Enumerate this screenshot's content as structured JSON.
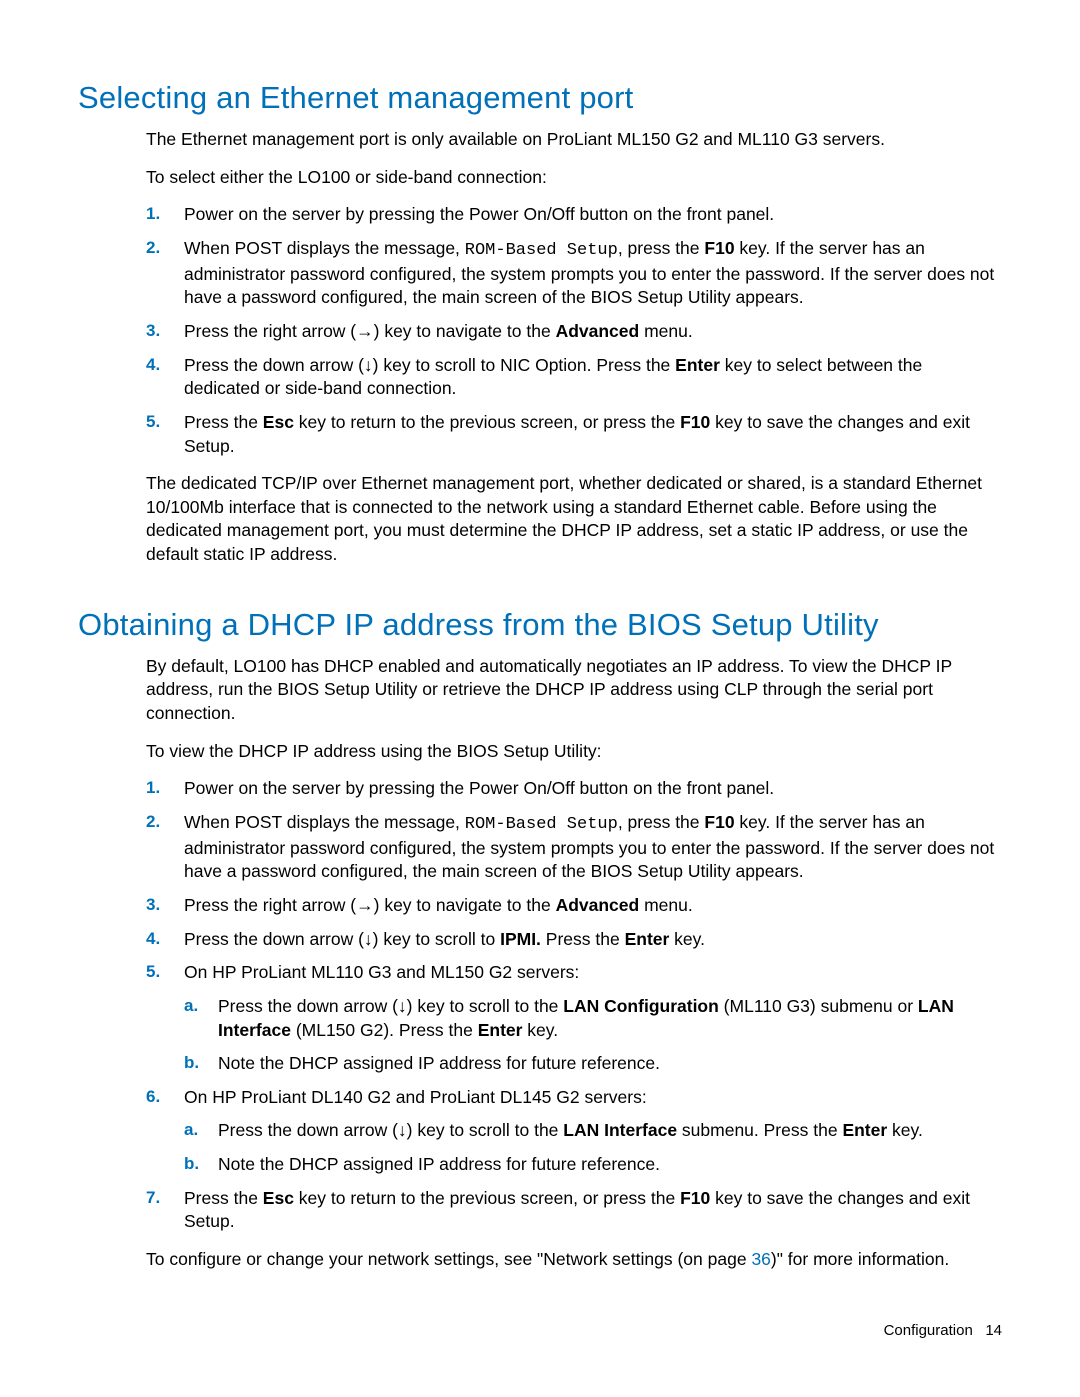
{
  "section1": {
    "title": "Selecting an Ethernet management port",
    "p1": "The Ethernet management port is only available on ProLiant ML150 G2 and ML110 G3 servers.",
    "p2": "To select either the LO100 or side-band connection:",
    "steps": {
      "s1": "Power on the server by pressing the Power On/Off button on the front panel.",
      "s2a": "When POST displays the message, ",
      "s2mono": "ROM-Based Setup",
      "s2b": ", press the ",
      "s2key": "F10",
      "s2c": " key. If the server has an administrator password configured, the system prompts you to enter the password. If the server does not have a password configured, the main screen of the BIOS Setup Utility appears.",
      "s3a": "Press the right arrow (→) key to navigate to the ",
      "s3bold": "Advanced",
      "s3b": " menu.",
      "s4a": "Press the down arrow (↓) key to scroll to NIC Option. Press the ",
      "s4bold": "Enter",
      "s4b": " key to select between the dedicated or side-band connection.",
      "s5a": "Press the ",
      "s5bold1": "Esc",
      "s5b": " key to return to the previous screen, or press the ",
      "s5bold2": "F10",
      "s5c": " key to save the changes and exit Setup."
    },
    "p3": "The dedicated TCP/IP over Ethernet management port, whether dedicated or shared, is a standard Ethernet 10/100Mb interface that is connected to the network using a standard Ethernet cable. Before using the dedicated management port, you must determine the DHCP IP address, set a static IP address, or use the default static IP address."
  },
  "section2": {
    "title": "Obtaining a DHCP IP address from the BIOS Setup Utility",
    "p1": "By default, LO100 has DHCP enabled and automatically negotiates an IP address. To view the DHCP IP address, run the BIOS Setup Utility or retrieve the DHCP IP address using CLP through the serial port connection.",
    "p2": "To view the DHCP IP address using the BIOS Setup Utility:",
    "steps": {
      "s1": "Power on the server by pressing the Power On/Off button on the front panel.",
      "s2a": "When POST displays the message, ",
      "s2mono": "ROM-Based Setup",
      "s2b": ", press the ",
      "s2key": "F10",
      "s2c": " key. If the server has an administrator password configured, the system prompts you to enter the password. If the server does not have a password configured, the main screen of the BIOS Setup Utility appears.",
      "s3a": "Press the right arrow (→) key to navigate to the ",
      "s3bold": "Advanced",
      "s3b": " menu.",
      "s4a": "Press the down arrow (↓) key to scroll to ",
      "s4bold1": "IPMI.",
      "s4b": " Press the ",
      "s4bold2": "Enter",
      "s4c": " key.",
      "s5": "On HP ProLiant ML110 G3 and ML150 G2 servers:",
      "s5a_a": "Press the down arrow (↓) key to scroll to the ",
      "s5a_b1": "LAN Configuration",
      "s5a_b": " (ML110 G3) submenu or ",
      "s5a_b2": "LAN Interface",
      "s5a_c": " (ML150 G2). Press the ",
      "s5a_b3": "Enter",
      "s5a_d": " key.",
      "s5b": "Note the DHCP assigned IP address for future reference.",
      "s6": "On HP ProLiant DL140 G2 and ProLiant DL145 G2 servers:",
      "s6a_a": "Press the down arrow (↓) key to scroll to the ",
      "s6a_b1": "LAN Interface",
      "s6a_b": " submenu. Press the ",
      "s6a_b2": "Enter",
      "s6a_c": " key.",
      "s6b": "Note the DHCP assigned IP address for future reference.",
      "s7a": "Press the ",
      "s7b1": "Esc",
      "s7b": " key to return to the previous screen, or press the ",
      "s7b2": "F10",
      "s7c": " key to save the changes and exit Setup."
    },
    "p3a": "To configure or change your network settings, see \"Network settings (on page ",
    "p3link": "36",
    "p3b": ")\" for more information."
  },
  "footer": {
    "label": "Configuration",
    "page": "14"
  }
}
